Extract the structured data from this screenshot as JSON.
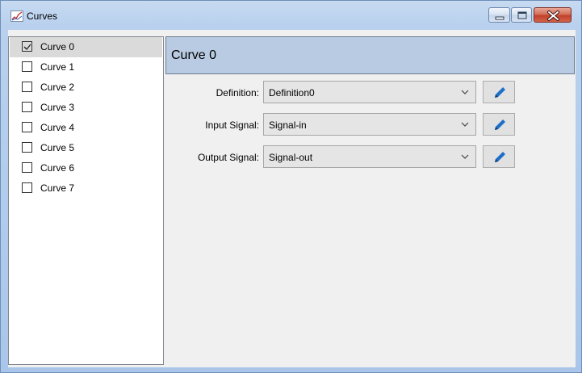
{
  "window": {
    "title": "Curves",
    "icon": "chart-line-icon",
    "controls": [
      "minimize-icon",
      "maximize-icon",
      "close-icon"
    ]
  },
  "curves": [
    {
      "label": "Curve 0",
      "checked": true,
      "selected": true
    },
    {
      "label": "Curve 1",
      "checked": false
    },
    {
      "label": "Curve 2",
      "checked": false
    },
    {
      "label": "Curve 3",
      "checked": false
    },
    {
      "label": "Curve 4",
      "checked": false
    },
    {
      "label": "Curve 5",
      "checked": false
    },
    {
      "label": "Curve 6",
      "checked": false
    },
    {
      "label": "Curve 7",
      "checked": false
    }
  ],
  "panel": {
    "title": "Curve 0",
    "fields": [
      {
        "label": "Definition:",
        "value": "Definition0",
        "icon": "pencil-icon"
      },
      {
        "label": "Input Signal:",
        "value": "Signal-in",
        "icon": "pencil-icon"
      },
      {
        "label": "Output Signal:",
        "value": "Signal-out",
        "icon": "pencil-icon"
      }
    ]
  },
  "colors": {
    "header_bg": "#b8cbe2",
    "selection_bg": "#dadada",
    "pencil_blue": "#1e6fc8",
    "frame_blue": "#b9d1ee"
  }
}
